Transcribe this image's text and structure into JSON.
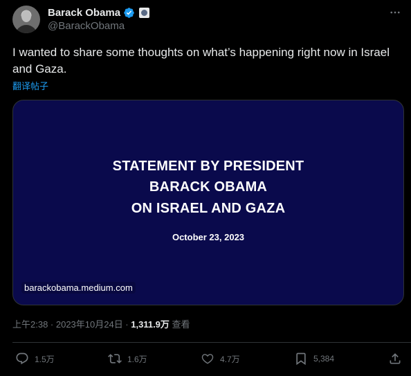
{
  "author": {
    "name": "Barack Obama",
    "handle": "@BarackObama",
    "verified_color": "#1d9bf0"
  },
  "tweet": {
    "text": "I wanted to share some thoughts on what’s happening right now in Israel and Gaza.",
    "translate_label": "翻译帖子"
  },
  "card": {
    "headline_line1": "STATEMENT BY PRESIDENT",
    "headline_line2": "BARACK OBAMA",
    "headline_line3": "ON ISRAEL AND GAZA",
    "date": "October 23, 2023",
    "domain": "barackobama.medium.com",
    "background_color": "#0a0a4c"
  },
  "meta": {
    "time_date": "上午2:38 · 2023年10月24日 · ",
    "views_count": "1,311.9万",
    "views_label": " 查看"
  },
  "actions": {
    "replies": "1.5万",
    "reposts": "1.6万",
    "likes": "4.7万",
    "bookmarks": "5,384"
  },
  "icons": {
    "more": "more-horizontal-icon",
    "reply": "reply-icon",
    "repost": "repost-icon",
    "like": "heart-icon",
    "bookmark": "bookmark-icon",
    "share": "share-icon"
  }
}
